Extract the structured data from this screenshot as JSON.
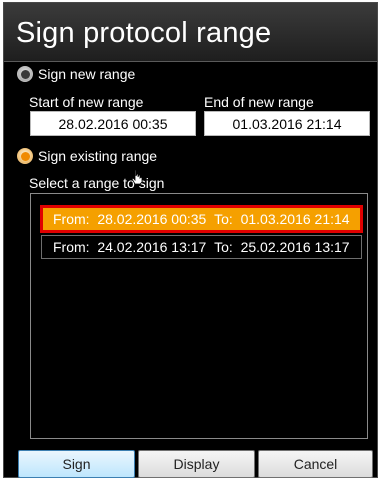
{
  "window": {
    "title": "Sign protocol range"
  },
  "sign_new": {
    "radio_label": "Sign new range",
    "selected": false,
    "start_label": "Start of new range",
    "start_value": "28.02.2016 00:35",
    "end_label": "End of new range",
    "end_value": "01.03.2016 21:14"
  },
  "sign_existing": {
    "radio_label": "Sign existing range",
    "selected": true,
    "list_label": "Select a range to sign",
    "ranges": [
      {
        "from_label": "From:",
        "from": "28.02.2016 00:35",
        "to_label": "To:",
        "to": "01.03.2016 21:14",
        "selected": true
      },
      {
        "from_label": "From:",
        "from": "24.02.2016 13:17",
        "to_label": "To:",
        "to": "25.02.2016 13:17",
        "selected": false
      }
    ]
  },
  "buttons": {
    "sign": "Sign",
    "display": "Display",
    "cancel": "Cancel"
  },
  "colors": {
    "selection_fill": "#f5a000",
    "selection_border": "#e00000",
    "background": "#000000"
  }
}
